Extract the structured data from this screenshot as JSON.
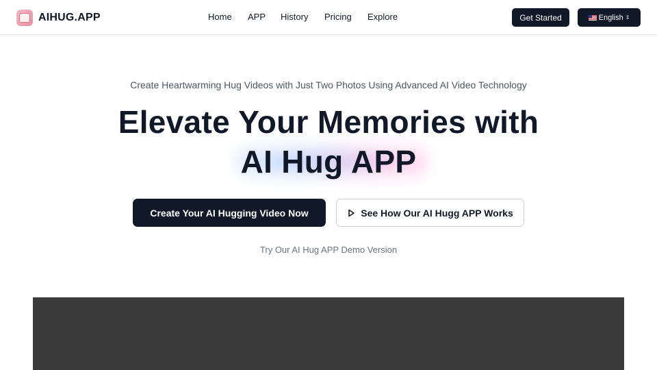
{
  "header": {
    "logo_text": "AIHUG.APP",
    "nav": [
      "Home",
      "APP",
      "History",
      "Pricing",
      "Explore"
    ],
    "get_started": "Get Started",
    "language": "English"
  },
  "hero": {
    "subtitle": "Create Heartwarming Hug Videos with Just Two Photos Using Advanced AI Video Technology",
    "headline_line1": "Elevate Your Memories with",
    "headline_line2": "AI Hug APP",
    "primary_button": "Create Your AI Hugging Video Now",
    "secondary_button": "See How Our AI Hugg APP Works",
    "demo_text": "Try Our AI Hug APP Demo Version"
  },
  "colors": {
    "primary_dark": "#111827",
    "video_bg": "#3a3a3a"
  },
  "icons": {
    "logo": "app-logo-icon",
    "flag": "us-flag-icon",
    "language_chevron": "chevron-up-down-icon",
    "play": "play-icon"
  }
}
